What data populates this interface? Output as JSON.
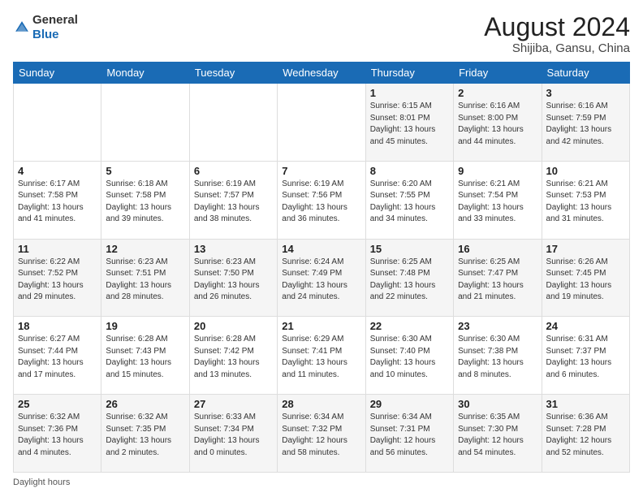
{
  "header": {
    "logo_general": "General",
    "logo_blue": "Blue",
    "main_title": "August 2024",
    "subtitle": "Shijiba, Gansu, China"
  },
  "days_of_week": [
    "Sunday",
    "Monday",
    "Tuesday",
    "Wednesday",
    "Thursday",
    "Friday",
    "Saturday"
  ],
  "weeks": [
    [
      {
        "num": "",
        "info": ""
      },
      {
        "num": "",
        "info": ""
      },
      {
        "num": "",
        "info": ""
      },
      {
        "num": "",
        "info": ""
      },
      {
        "num": "1",
        "info": "Sunrise: 6:15 AM\nSunset: 8:01 PM\nDaylight: 13 hours\nand 45 minutes."
      },
      {
        "num": "2",
        "info": "Sunrise: 6:16 AM\nSunset: 8:00 PM\nDaylight: 13 hours\nand 44 minutes."
      },
      {
        "num": "3",
        "info": "Sunrise: 6:16 AM\nSunset: 7:59 PM\nDaylight: 13 hours\nand 42 minutes."
      }
    ],
    [
      {
        "num": "4",
        "info": "Sunrise: 6:17 AM\nSunset: 7:58 PM\nDaylight: 13 hours\nand 41 minutes."
      },
      {
        "num": "5",
        "info": "Sunrise: 6:18 AM\nSunset: 7:58 PM\nDaylight: 13 hours\nand 39 minutes."
      },
      {
        "num": "6",
        "info": "Sunrise: 6:19 AM\nSunset: 7:57 PM\nDaylight: 13 hours\nand 38 minutes."
      },
      {
        "num": "7",
        "info": "Sunrise: 6:19 AM\nSunset: 7:56 PM\nDaylight: 13 hours\nand 36 minutes."
      },
      {
        "num": "8",
        "info": "Sunrise: 6:20 AM\nSunset: 7:55 PM\nDaylight: 13 hours\nand 34 minutes."
      },
      {
        "num": "9",
        "info": "Sunrise: 6:21 AM\nSunset: 7:54 PM\nDaylight: 13 hours\nand 33 minutes."
      },
      {
        "num": "10",
        "info": "Sunrise: 6:21 AM\nSunset: 7:53 PM\nDaylight: 13 hours\nand 31 minutes."
      }
    ],
    [
      {
        "num": "11",
        "info": "Sunrise: 6:22 AM\nSunset: 7:52 PM\nDaylight: 13 hours\nand 29 minutes."
      },
      {
        "num": "12",
        "info": "Sunrise: 6:23 AM\nSunset: 7:51 PM\nDaylight: 13 hours\nand 28 minutes."
      },
      {
        "num": "13",
        "info": "Sunrise: 6:23 AM\nSunset: 7:50 PM\nDaylight: 13 hours\nand 26 minutes."
      },
      {
        "num": "14",
        "info": "Sunrise: 6:24 AM\nSunset: 7:49 PM\nDaylight: 13 hours\nand 24 minutes."
      },
      {
        "num": "15",
        "info": "Sunrise: 6:25 AM\nSunset: 7:48 PM\nDaylight: 13 hours\nand 22 minutes."
      },
      {
        "num": "16",
        "info": "Sunrise: 6:25 AM\nSunset: 7:47 PM\nDaylight: 13 hours\nand 21 minutes."
      },
      {
        "num": "17",
        "info": "Sunrise: 6:26 AM\nSunset: 7:45 PM\nDaylight: 13 hours\nand 19 minutes."
      }
    ],
    [
      {
        "num": "18",
        "info": "Sunrise: 6:27 AM\nSunset: 7:44 PM\nDaylight: 13 hours\nand 17 minutes."
      },
      {
        "num": "19",
        "info": "Sunrise: 6:28 AM\nSunset: 7:43 PM\nDaylight: 13 hours\nand 15 minutes."
      },
      {
        "num": "20",
        "info": "Sunrise: 6:28 AM\nSunset: 7:42 PM\nDaylight: 13 hours\nand 13 minutes."
      },
      {
        "num": "21",
        "info": "Sunrise: 6:29 AM\nSunset: 7:41 PM\nDaylight: 13 hours\nand 11 minutes."
      },
      {
        "num": "22",
        "info": "Sunrise: 6:30 AM\nSunset: 7:40 PM\nDaylight: 13 hours\nand 10 minutes."
      },
      {
        "num": "23",
        "info": "Sunrise: 6:30 AM\nSunset: 7:38 PM\nDaylight: 13 hours\nand 8 minutes."
      },
      {
        "num": "24",
        "info": "Sunrise: 6:31 AM\nSunset: 7:37 PM\nDaylight: 13 hours\nand 6 minutes."
      }
    ],
    [
      {
        "num": "25",
        "info": "Sunrise: 6:32 AM\nSunset: 7:36 PM\nDaylight: 13 hours\nand 4 minutes."
      },
      {
        "num": "26",
        "info": "Sunrise: 6:32 AM\nSunset: 7:35 PM\nDaylight: 13 hours\nand 2 minutes."
      },
      {
        "num": "27",
        "info": "Sunrise: 6:33 AM\nSunset: 7:34 PM\nDaylight: 13 hours\nand 0 minutes."
      },
      {
        "num": "28",
        "info": "Sunrise: 6:34 AM\nSunset: 7:32 PM\nDaylight: 12 hours\nand 58 minutes."
      },
      {
        "num": "29",
        "info": "Sunrise: 6:34 AM\nSunset: 7:31 PM\nDaylight: 12 hours\nand 56 minutes."
      },
      {
        "num": "30",
        "info": "Sunrise: 6:35 AM\nSunset: 7:30 PM\nDaylight: 12 hours\nand 54 minutes."
      },
      {
        "num": "31",
        "info": "Sunrise: 6:36 AM\nSunset: 7:28 PM\nDaylight: 12 hours\nand 52 minutes."
      }
    ]
  ],
  "footer": {
    "daylight_label": "Daylight hours"
  }
}
